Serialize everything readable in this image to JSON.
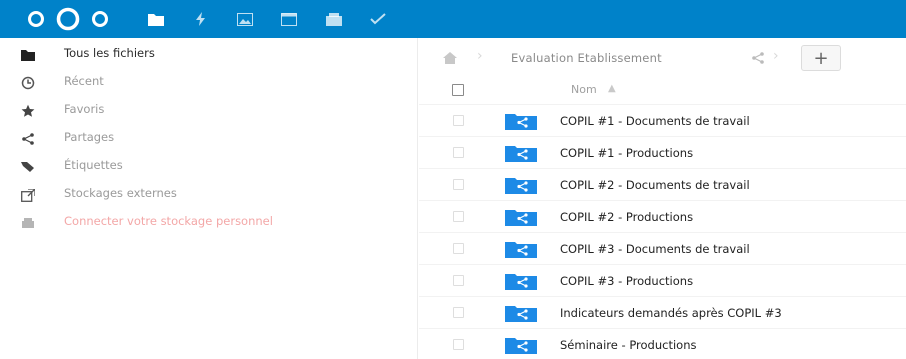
{
  "colors": {
    "header": "#0082c9",
    "folder": "#1d8ae6",
    "danger_text": "#f3a7a7"
  },
  "header": {
    "logo": "nextcloud-logo",
    "apps": [
      {
        "icon": "files-icon"
      },
      {
        "icon": "activity-icon"
      },
      {
        "icon": "gallery-icon"
      },
      {
        "icon": "calendar-icon"
      },
      {
        "icon": "mail-icon"
      },
      {
        "icon": "tasks-icon"
      }
    ]
  },
  "sidebar": {
    "items": [
      {
        "label": "Tous les fichiers",
        "icon": "folder-icon",
        "active": true
      },
      {
        "label": "Récent",
        "icon": "clock-icon"
      },
      {
        "label": "Favoris",
        "icon": "star-icon"
      },
      {
        "label": "Partages",
        "icon": "share-icon"
      },
      {
        "label": "Étiquettes",
        "icon": "tag-icon"
      },
      {
        "label": "Stockages externes",
        "icon": "external-storage-icon"
      },
      {
        "label": "Connecter votre stockage personnel",
        "icon": "storage-connect-icon",
        "danger": true
      }
    ]
  },
  "breadcrumb": {
    "home_icon": "home-icon",
    "folder": "Evaluation Etablissement",
    "share_icon": "share-icon",
    "new_button": "+"
  },
  "table": {
    "header": {
      "name": "Nom",
      "sort_indicator": "▲"
    },
    "rows": [
      {
        "name": "COPIL #1 - Documents de travail",
        "icon": "shared-folder-icon"
      },
      {
        "name": "COPIL #1 - Productions",
        "icon": "shared-folder-icon"
      },
      {
        "name": "COPIL #2 - Documents de travail",
        "icon": "shared-folder-icon"
      },
      {
        "name": "COPIL #2 - Productions",
        "icon": "shared-folder-icon"
      },
      {
        "name": "COPIL #3 - Documents de travail",
        "icon": "shared-folder-icon"
      },
      {
        "name": "COPIL #3 - Productions",
        "icon": "shared-folder-icon"
      },
      {
        "name": "Indicateurs demandés après COPIL #3",
        "icon": "shared-folder-icon"
      },
      {
        "name": "Séminaire - Productions",
        "icon": "shared-folder-icon"
      }
    ]
  }
}
